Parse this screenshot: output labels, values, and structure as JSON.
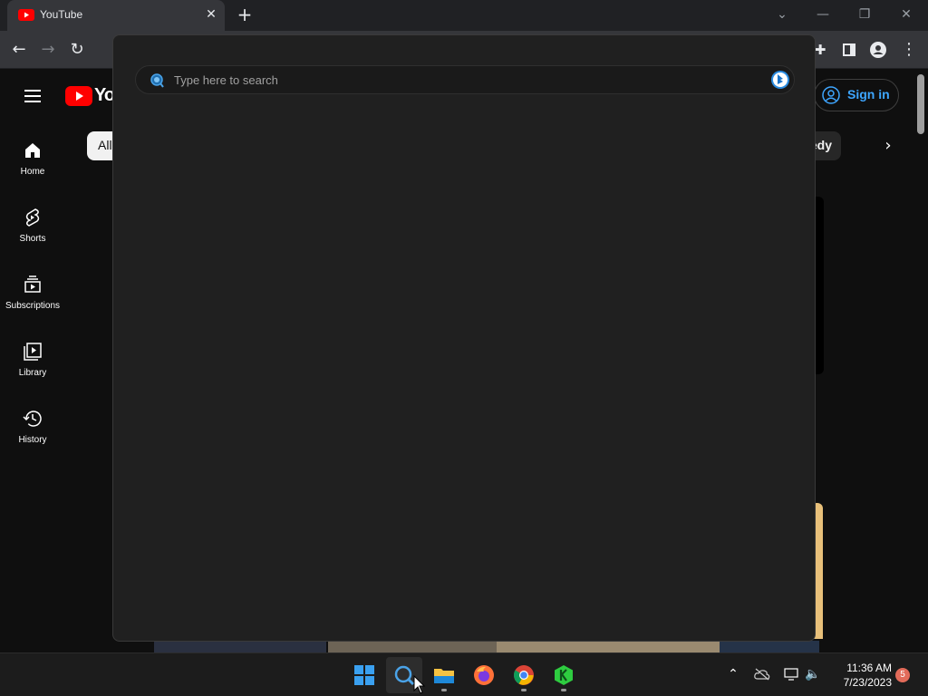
{
  "browser": {
    "tab": {
      "title": "YouTube",
      "close_label": "✕"
    },
    "new_tab_label": "+"
  },
  "youtube": {
    "logo_text": "You",
    "sign_in_label": "Sign in",
    "chips": {
      "all": "All",
      "partial": "edy"
    },
    "sidebar": [
      {
        "label": "Home",
        "icon": "home-icon"
      },
      {
        "label": "Shorts",
        "icon": "shorts-icon"
      },
      {
        "label": "Subscriptions",
        "icon": "subscriptions-icon"
      },
      {
        "label": "Library",
        "icon": "library-icon"
      },
      {
        "label": "History",
        "icon": "history-icon"
      }
    ]
  },
  "search_flyout": {
    "placeholder": "Type here to search"
  },
  "taskbar": {
    "apps": [
      "windows-start",
      "search",
      "file-explorer",
      "firefox",
      "chrome",
      "kleopatra"
    ],
    "clock": {
      "time": "11:36 AM",
      "date": "7/23/2023"
    },
    "notification_count": "5"
  },
  "colors": {
    "youtube_red": "#ff0000",
    "link_blue": "#3ea6ff",
    "flyout_bg": "#202020"
  }
}
